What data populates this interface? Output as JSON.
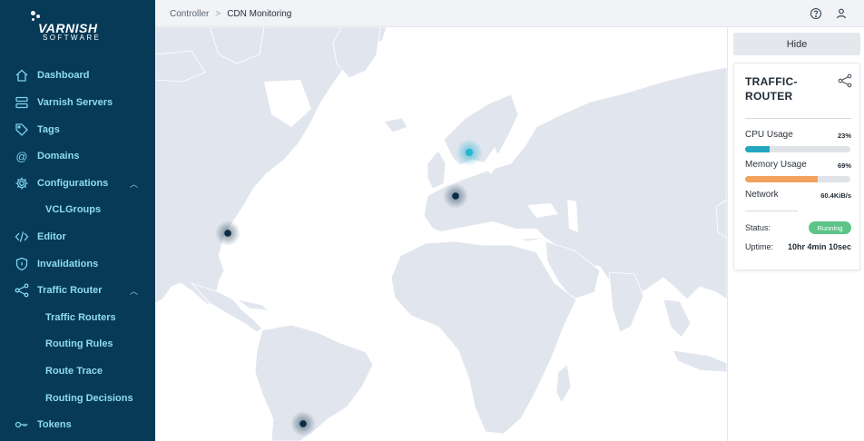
{
  "brand": {
    "name": "VARNISH",
    "sub": "SOFTWARE"
  },
  "colors": {
    "sidebar_bg": "#063a56",
    "sidebar_text": "#8fdcf1",
    "land": "#e1e6ee",
    "cpu_bar": "#23a6c0",
    "memory_bar": "#f1a35e",
    "status_running": "#5cc487",
    "marker_dark": "#0c2c45",
    "marker_light": "#28b3cf"
  },
  "nav": {
    "items": [
      {
        "label": "Dashboard",
        "icon": "home-icon"
      },
      {
        "label": "Varnish Servers",
        "icon": "servers-icon"
      },
      {
        "label": "Tags",
        "icon": "tag-icon"
      },
      {
        "label": "Domains",
        "icon": "at-icon"
      },
      {
        "label": "Configurations",
        "icon": "gear-icon",
        "expanded": true
      },
      {
        "label": "VCLGroups",
        "sub": true
      },
      {
        "label": "Editor",
        "icon": "code-icon"
      },
      {
        "label": "Invalidations",
        "icon": "shield-icon"
      },
      {
        "label": "Traffic Router",
        "icon": "share-icon",
        "expanded": true
      },
      {
        "label": "Traffic Routers",
        "sub": true
      },
      {
        "label": "Routing Rules",
        "sub": true
      },
      {
        "label": "Route Trace",
        "sub": true
      },
      {
        "label": "Routing Decisions",
        "sub": true
      },
      {
        "label": "Tokens",
        "icon": "key-icon"
      }
    ]
  },
  "breadcrumb": {
    "parent": "Controller",
    "separator": ">",
    "current": "CDN Monitoring"
  },
  "topbar": {
    "help_icon": "help-circle-icon",
    "user_icon": "user-icon"
  },
  "panel": {
    "hide_label": "Hide",
    "title": "TRAFFIC-ROUTER",
    "share_icon": "share-icon",
    "cpu": {
      "label": "CPU Usage",
      "value": "23%",
      "fraction": 0.23
    },
    "memory": {
      "label": "Memory Usage",
      "value": "69%",
      "fraction": 0.69
    },
    "network": {
      "label": "Network",
      "value": "60.4KiB/s"
    },
    "status": {
      "label": "Status:",
      "value": "Running"
    },
    "uptime": {
      "label": "Uptime:",
      "value": "10hr 4min 10sec"
    }
  },
  "map": {
    "markers": [
      {
        "name": "stockholm-marker",
        "style": "light"
      },
      {
        "name": "frankfurt-marker",
        "style": "dark"
      },
      {
        "name": "new-york-marker",
        "style": "dark"
      },
      {
        "name": "sao-paulo-marker",
        "style": "dark"
      }
    ]
  }
}
